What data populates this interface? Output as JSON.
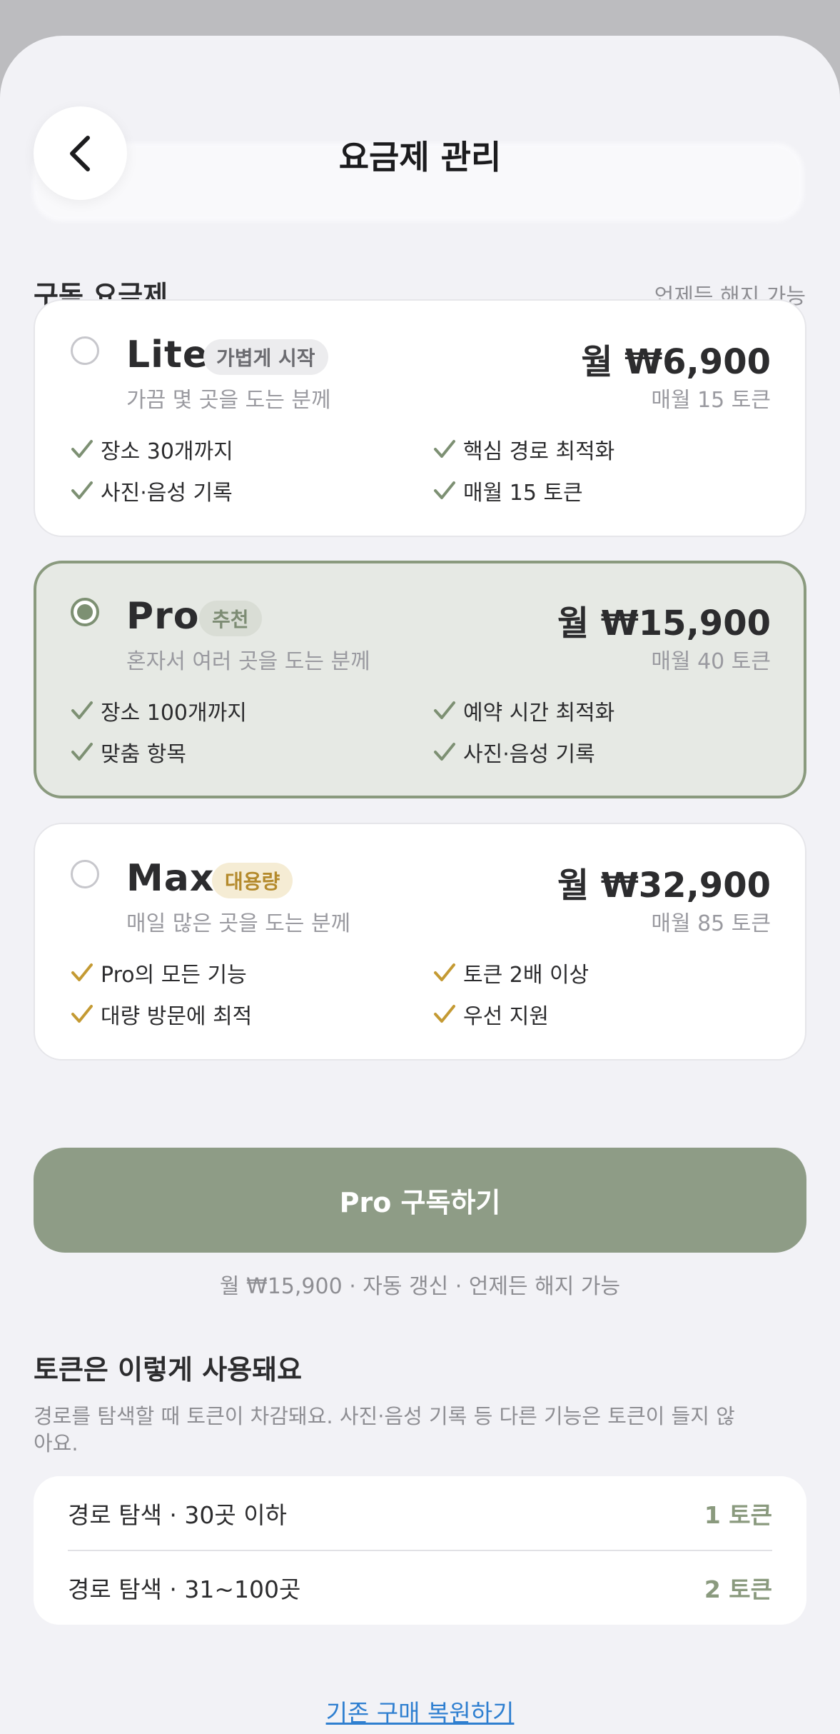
{
  "header": {
    "title": "요금제 관리"
  },
  "section": {
    "title": "구독 요금제",
    "note": "언제든 해지 가능"
  },
  "plans": [
    {
      "name": "Lite",
      "badge": "가볍게 시작",
      "subtitle": "가끔 몇 곳을 도는 분께",
      "price": "월 ₩6,900",
      "tokens": "매월 15 토큰",
      "selected": false,
      "features": [
        "장소 30개까지",
        "핵심 경로 최적화",
        "사진·음성 기록",
        "매월 15 토큰"
      ]
    },
    {
      "name": "Pro",
      "badge": "추천",
      "subtitle": "혼자서 여러 곳을 도는 분께",
      "price": "월 ₩15,900",
      "tokens": "매월 40 토큰",
      "selected": true,
      "features": [
        "장소 100개까지",
        "예약 시간 최적화",
        "맞춤 항목",
        "사진·음성 기록"
      ]
    },
    {
      "name": "Max",
      "badge": "대용량",
      "subtitle": "매일 많은 곳을 도는 분께",
      "price": "월 ₩32,900",
      "tokens": "매월 85 토큰",
      "selected": false,
      "features": [
        "Pro의 모든 기능",
        "토큰 2배 이상",
        "대량 방문에 최적",
        "우선 지원"
      ]
    }
  ],
  "cta": {
    "label": "Pro 구독하기",
    "note": "월 ₩15,900 · 자동 갱신 · 언제든 해지 가능"
  },
  "token_info": {
    "title": "토큰은 이렇게 사용돼요",
    "description": "경로를 탐색할 때 토큰이 차감돼요. 사진·음성 기록 등 다른 기능은 토큰이 들지 않아요.",
    "rows": [
      {
        "label": "경로 탐색 · 30곳 이하",
        "value": "1 토큰"
      },
      {
        "label": "경로 탐색 · 31~100곳",
        "value": "2 토큰"
      }
    ]
  },
  "footer": {
    "restore_label": "기존 구매 복원하기"
  },
  "colors": {
    "accent": "#8e9c86",
    "selected_border": "#8a9a7e",
    "check_green": "#7d9073",
    "check_gold": "#c49a33",
    "link": "#2f7fd0"
  },
  "icons": {
    "back": "chevron-left-icon",
    "check": "checkmark-icon"
  }
}
